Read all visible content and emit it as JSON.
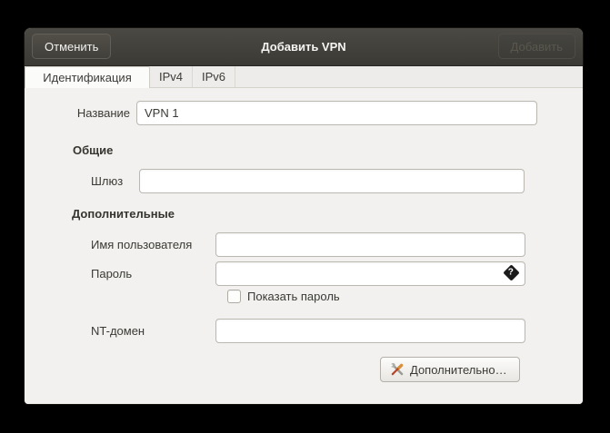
{
  "titlebar": {
    "title": "Добавить VPN",
    "cancel_button": "Отменить",
    "add_button": "Добавить",
    "add_button_enabled": false
  },
  "tabs": {
    "items": [
      {
        "label": "Идентификация",
        "active": true
      },
      {
        "label": "IPv4",
        "active": false
      },
      {
        "label": "IPv6",
        "active": false
      }
    ]
  },
  "form": {
    "name": {
      "label": "Название",
      "value": "VPN 1"
    },
    "general": {
      "heading": "Общие",
      "gateway": {
        "label": "Шлюз",
        "value": ""
      }
    },
    "advanced": {
      "heading": "Дополнительные",
      "username": {
        "label": "Имя пользователя",
        "value": ""
      },
      "password": {
        "label": "Пароль",
        "value": "",
        "icon": "password-storage-question-icon"
      },
      "show_password": {
        "label": "Показать пароль",
        "checked": false
      },
      "nt_domain": {
        "label": "NT-домен",
        "value": ""
      }
    },
    "advanced_button": {
      "label": "Дополнительно…",
      "icon": "crossed-tools-icon"
    }
  },
  "colors": {
    "titlebar_bg": "#45433e",
    "content_bg": "#f2f1ef",
    "active_tab_bg": "#fbfbfa",
    "entry_border": "#bbb8b2",
    "disabled_text": "#59574d",
    "screwdriver_orange": "#cd6632",
    "wrench_gray": "#9b9c98"
  }
}
